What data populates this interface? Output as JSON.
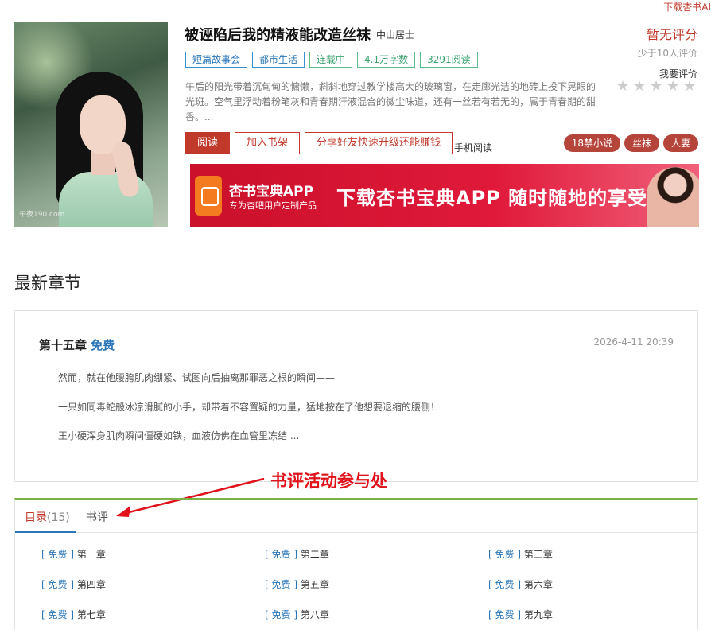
{
  "top_link": "下载杏书AI",
  "book": {
    "title": "被诬陷后我的精液能改造丝袜",
    "author": "中山居士",
    "tags": [
      {
        "label": "短篇故事会",
        "style": "blue"
      },
      {
        "label": "都市生活",
        "style": "blue"
      },
      {
        "label": "连载中",
        "style": "green"
      },
      {
        "label": "4.1万字数",
        "style": "green"
      },
      {
        "label": "3291阅读",
        "style": "green"
      }
    ],
    "description": "午后的阳光带着沉甸甸的慵懒，斜斜地穿过教学楼高大的玻璃窗，在走廊光洁的地砖上投下晃眼的光斑。空气里浮动着粉笔灰和青春期汗液混合的微尘味道，还有一丝若有若无的，属于青春期的甜香。...",
    "cover_watermark": "午夜190.com"
  },
  "buttons": {
    "read": "阅读",
    "shelf": "加入书架",
    "share": "分享好友快速升级还能赚钱",
    "mobile": "手机阅读"
  },
  "rating": {
    "score": "暂无评分",
    "sub": "少于10人评价",
    "rate_label": "我要评价",
    "stars": 5
  },
  "pills": [
    "18禁小说",
    "丝袜",
    "人妻"
  ],
  "banner": {
    "app_name": "杏书宝典APP",
    "app_sub": "专为杏吧用户定制产品",
    "slogan": "下载杏书宝典APP 随时随地的享受"
  },
  "latest": {
    "section_title": "最新章节",
    "chapter": "第十五章",
    "free": "免费",
    "time": "2026-4-11 20:39",
    "lines": [
      "然而，就在他腰胯肌肉绷紧、试图向后抽离那罪恶之根的瞬间——",
      "一只如同毒蛇般冰凉滑腻的小手，却带着不容置疑的力量，猛地按在了他想要退缩的腰侧！",
      "王小硬浑身肌肉瞬间僵硬如铁，血液仿佛在血管里冻结 ..."
    ]
  },
  "annotation": "书评活动参与处",
  "tabs": {
    "toc": "目录",
    "toc_count": "(15)",
    "review": "书评"
  },
  "chapters": [
    {
      "free": "免费",
      "name": "第一章"
    },
    {
      "free": "免费",
      "name": "第二章"
    },
    {
      "free": "免费",
      "name": "第三章"
    },
    {
      "free": "免费",
      "name": "第四章"
    },
    {
      "free": "免费",
      "name": "第五章"
    },
    {
      "free": "免费",
      "name": "第六章"
    },
    {
      "free": "免费",
      "name": "第七章"
    },
    {
      "free": "免费",
      "name": "第八章"
    },
    {
      "free": "免费",
      "name": "第九章"
    }
  ],
  "colors": {
    "accent_red": "#c0392b",
    "link_blue": "#2a76b8",
    "tab_green": "#7db246",
    "annotation_red": "#e0121b"
  }
}
